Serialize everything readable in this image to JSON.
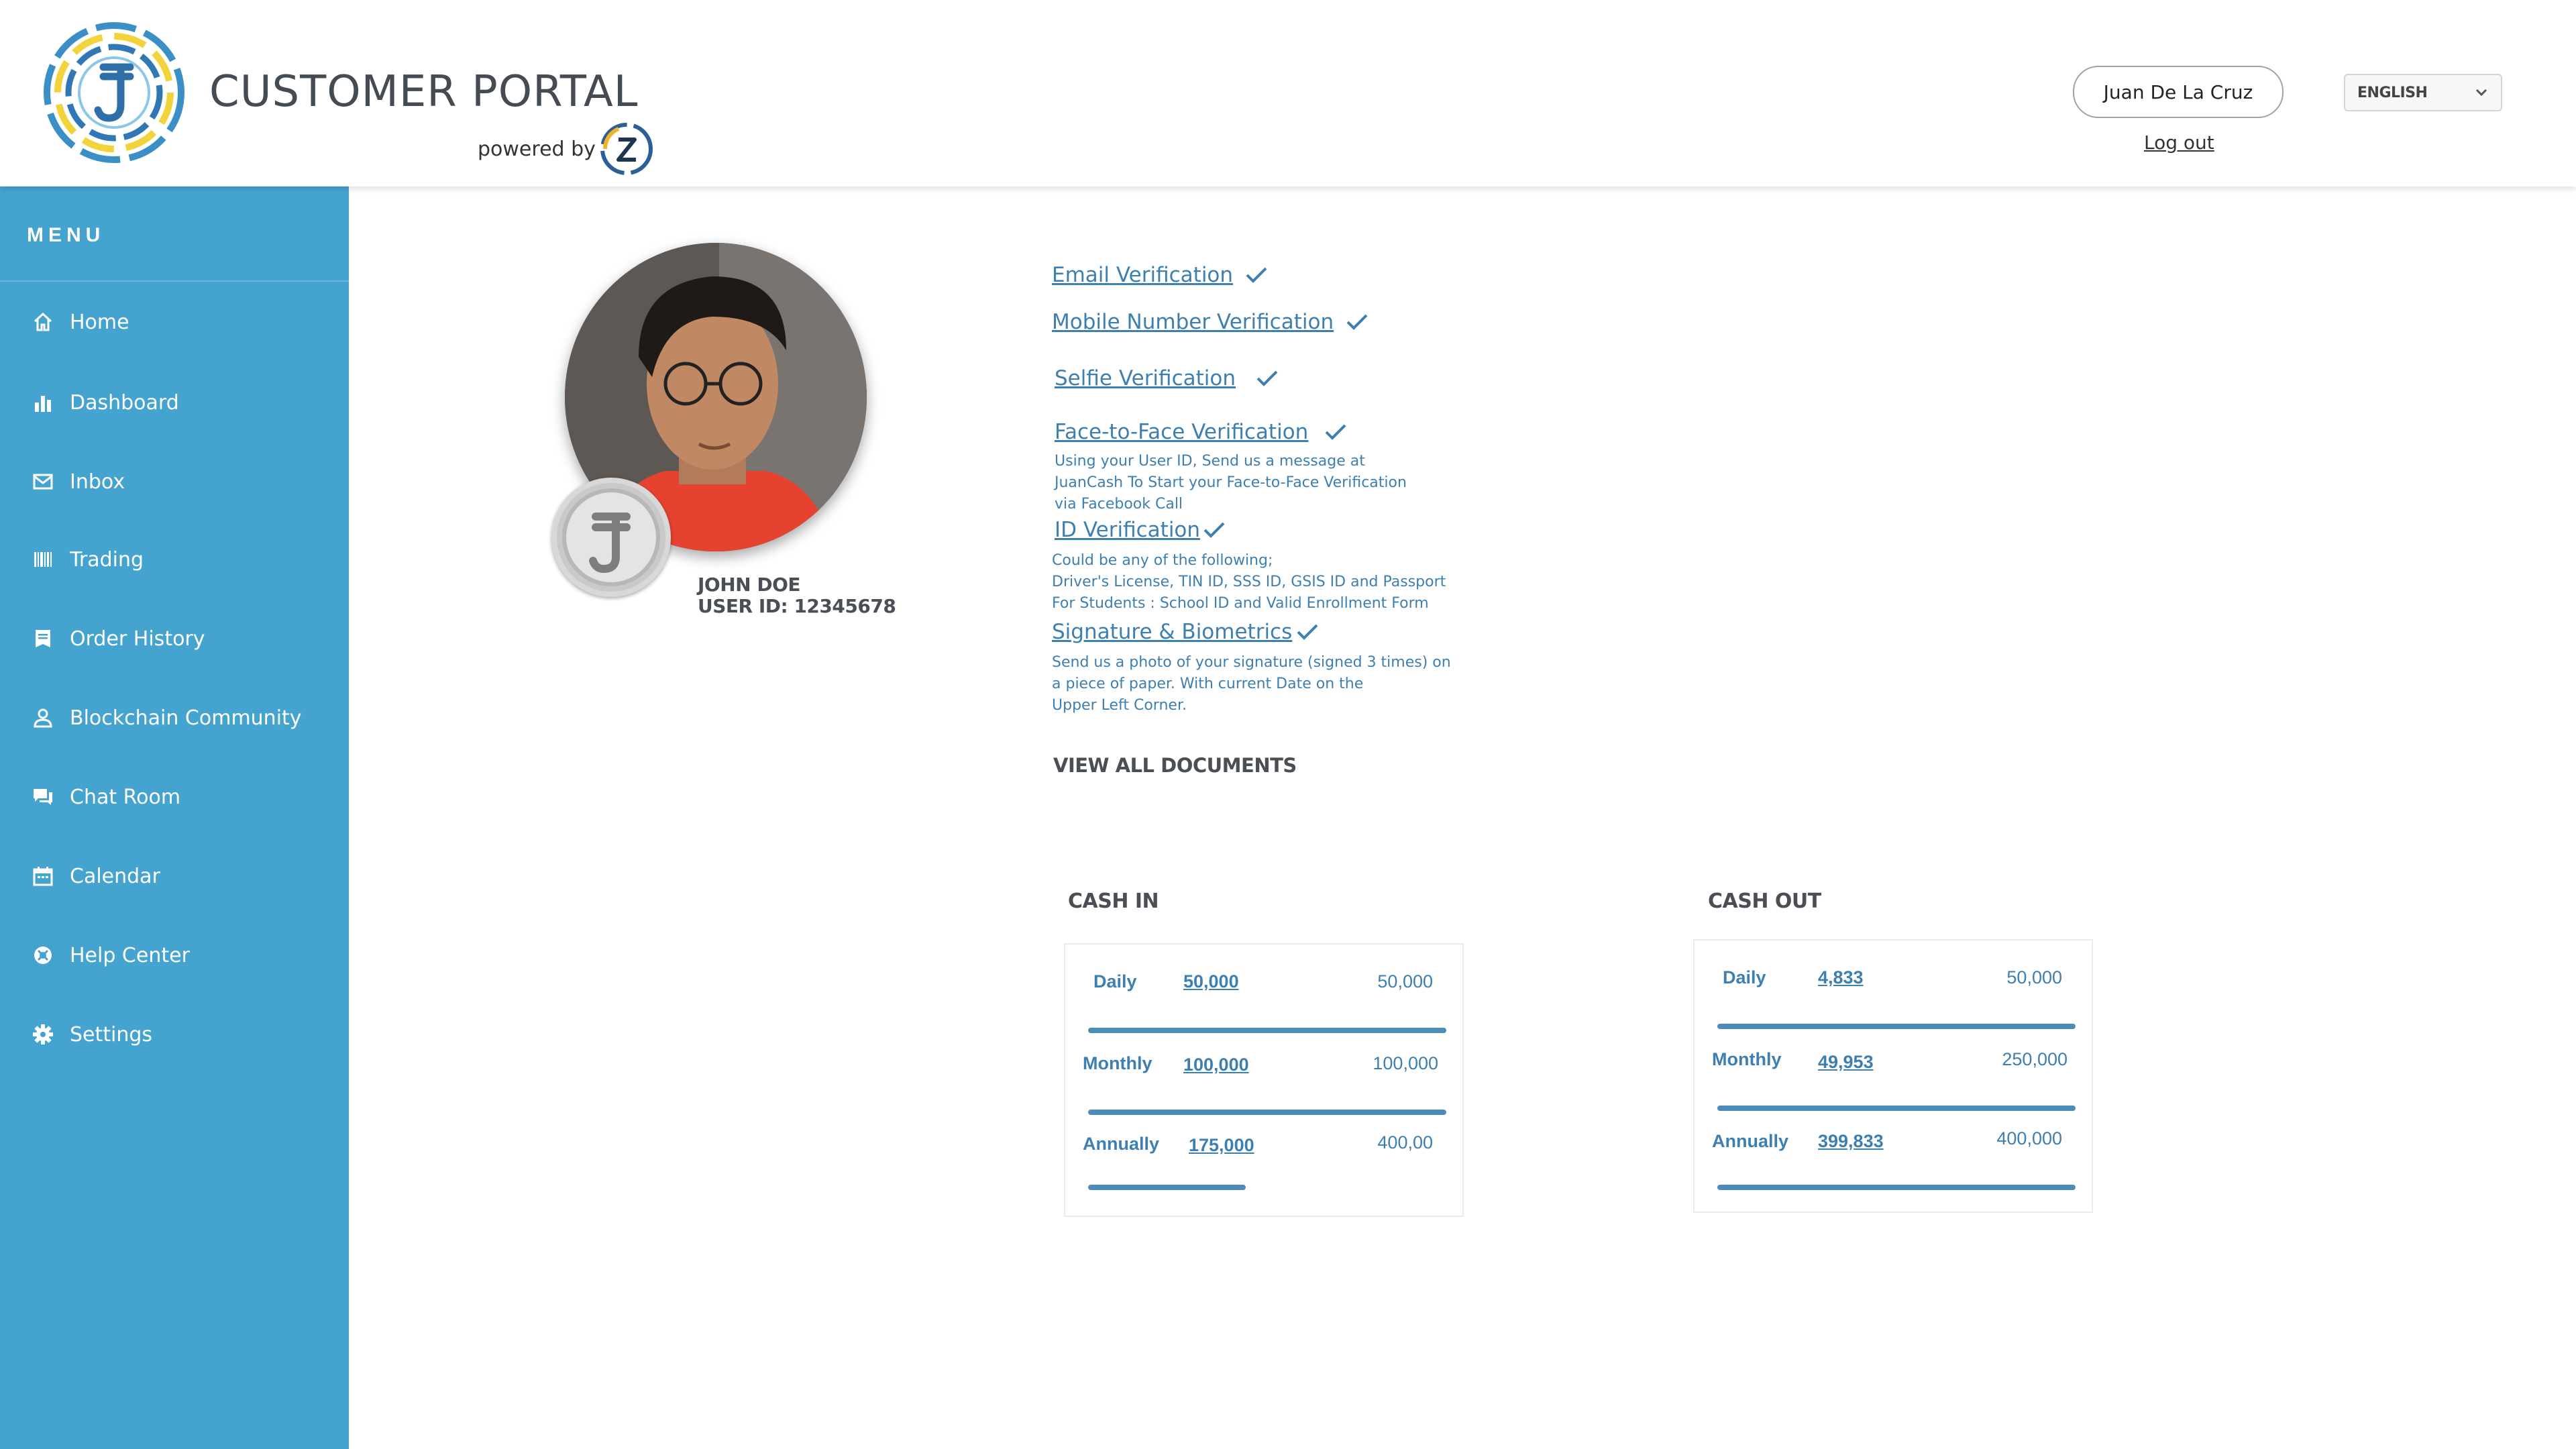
{
  "header": {
    "title": "CUSTOMER PORTAL",
    "powered_by": "powered by :",
    "user_name": "Juan De La Cruz",
    "logout": "Log out",
    "language": "ENGLISH"
  },
  "sidebar": {
    "menu_title": "MENU",
    "items": [
      {
        "label": "Home",
        "icon": "home-icon"
      },
      {
        "label": "Dashboard",
        "icon": "bar-chart-icon"
      },
      {
        "label": "Inbox",
        "icon": "mail-icon"
      },
      {
        "label": "Trading",
        "icon": "barcode-icon"
      },
      {
        "label": "Order History",
        "icon": "receipt-icon"
      },
      {
        "label": "Blockchain Community",
        "icon": "person-icon"
      },
      {
        "label": "Chat Room",
        "icon": "chat-icon"
      },
      {
        "label": "Calendar",
        "icon": "calendar-icon"
      },
      {
        "label": "Help Center",
        "icon": "lifebuoy-icon"
      },
      {
        "label": "Settings",
        "icon": "gear-icon"
      }
    ]
  },
  "profile": {
    "name": "JOHN DOE",
    "user_id": "USER ID: 12345678"
  },
  "verifications": {
    "email": "Email Verification",
    "mobile": "Mobile Number Verification",
    "selfie": "Selfie Verification",
    "face": "Face-to-Face Verification",
    "face_note": [
      "Using your User ID, Send us a message at",
      "JuanCash To Start your Face-to-Face Verification",
      "via Facebook Call"
    ],
    "id": "ID Verification",
    "id_note": [
      "Could be any of the following;",
      "Driver's License, TIN ID, SSS ID, GSIS ID and Passport",
      "For Students : School ID and Valid Enrollment Form"
    ],
    "signature": "Signature & Biometrics",
    "signature_note": [
      "Send us a photo of your signature (signed 3 times) on",
      "a piece of paper. With current Date on the",
      "Upper Left Corner."
    ],
    "view_all": "VIEW ALL DOCUMENTS"
  },
  "cash_in": {
    "title": "CASH IN",
    "rows": [
      {
        "label": "Daily",
        "used": "50,000",
        "limit": "50,000",
        "progress": 1.0
      },
      {
        "label": "Monthly",
        "used": "100,000",
        "limit": "100,000",
        "progress": 1.0
      },
      {
        "label": "Annually",
        "used": "175,000",
        "limit": "400,00",
        "progress": 0.44
      }
    ]
  },
  "cash_out": {
    "title": "CASH OUT",
    "rows": [
      {
        "label": "Daily",
        "used": "4,833",
        "limit": "50,000",
        "progress": 1.0
      },
      {
        "label": "Monthly",
        "used": "49,953",
        "limit": "250,000",
        "progress": 1.0
      },
      {
        "label": "Annually",
        "used": "399,833",
        "limit": "400,000",
        "progress": 1.0
      }
    ]
  },
  "colors": {
    "sidebar": "#45a3d0",
    "link": "#3d7fb0",
    "bar": "#4b8db8"
  }
}
